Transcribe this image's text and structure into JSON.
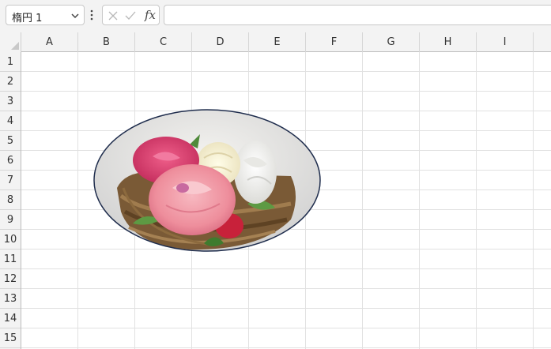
{
  "name_box": {
    "value": "楕円 1"
  },
  "formula_bar": {
    "value": "",
    "fx_label": "fx"
  },
  "columns": [
    "A",
    "B",
    "C",
    "D",
    "E",
    "F",
    "G",
    "H",
    "I"
  ],
  "rows": [
    "1",
    "2",
    "3",
    "4",
    "5",
    "6",
    "7",
    "8",
    "9",
    "10",
    "11",
    "12",
    "13",
    "14",
    "15"
  ],
  "shape": {
    "name": "楕円 1",
    "outline_color": "#1f2d4d"
  },
  "colors": {
    "grid_line": "#e1e1e1",
    "header_bg": "#f3f3f3"
  }
}
